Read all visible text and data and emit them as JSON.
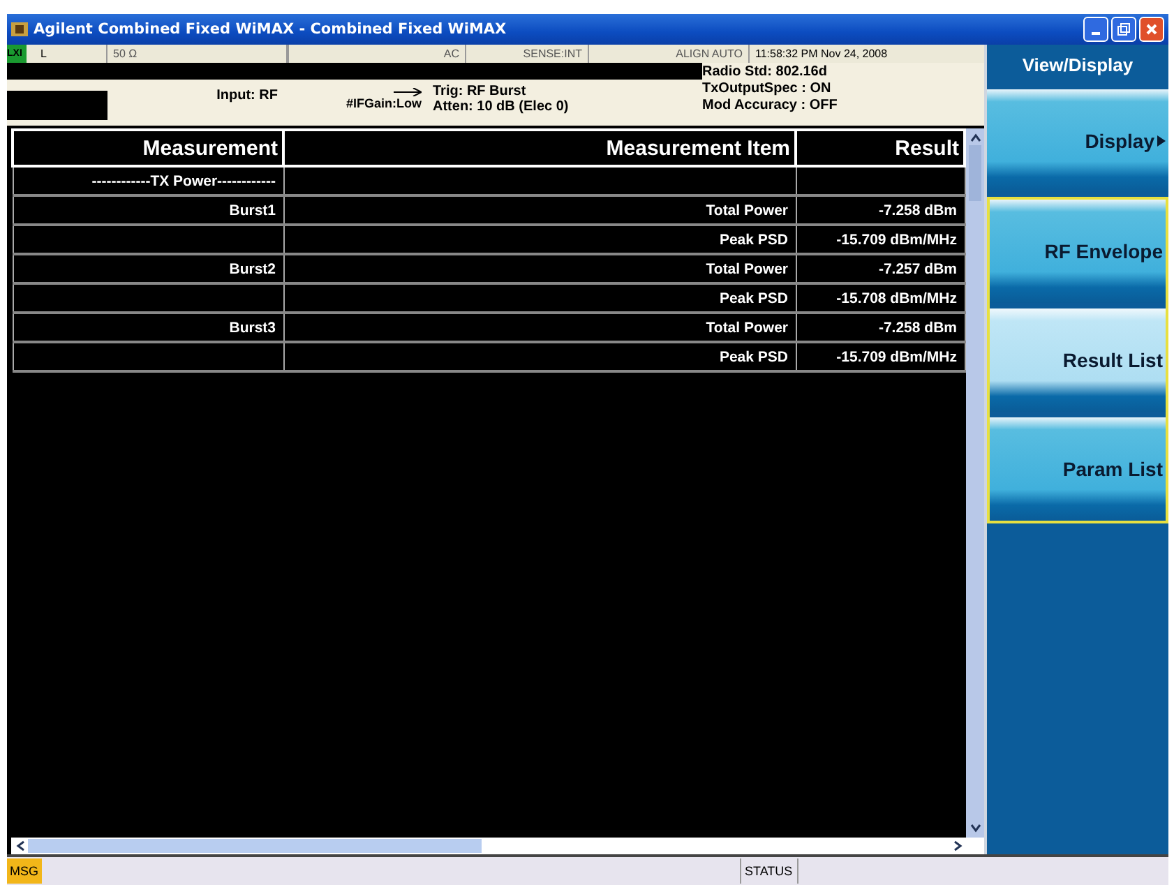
{
  "window": {
    "title": "Agilent Combined Fixed WiMAX - Combined Fixed WiMAX"
  },
  "status_strip": {
    "indicator": "LXI",
    "cells": [
      "L",
      "50 Ω",
      "AC",
      "SENSE:INT",
      "ALIGN AUTO"
    ],
    "datetime": "11:58:32 PM Nov 24, 2008"
  },
  "info": {
    "input": "Input: RF",
    "if_gain": "#IFGain:Low",
    "trigger": "Trig: RF Burst",
    "atten": "Atten: 10 dB (Elec 0)",
    "radio_lines": [
      "Radio Std: 802.16d",
      "TxOutputSpec : ON",
      "Mod Accuracy : OFF"
    ]
  },
  "table": {
    "columns": [
      "Measurement",
      "Measurement Item",
      "Result"
    ],
    "rows": [
      {
        "measurement": "------------TX Power------------",
        "item": "",
        "result": ""
      },
      {
        "measurement": "Burst1",
        "item": "Total Power",
        "result": "-7.258 dBm"
      },
      {
        "measurement": "",
        "item": "Peak PSD",
        "result": "-15.709 dBm/MHz"
      },
      {
        "measurement": "Burst2",
        "item": "Total Power",
        "result": "-7.257 dBm"
      },
      {
        "measurement": "",
        "item": "Peak PSD",
        "result": "-15.708 dBm/MHz"
      },
      {
        "measurement": "Burst3",
        "item": "Total Power",
        "result": "-7.258 dBm"
      },
      {
        "measurement": "",
        "item": "Peak PSD",
        "result": "-15.709 dBm/MHz"
      }
    ]
  },
  "softkeys": {
    "title": "View/Display",
    "keys": [
      {
        "label": "Display",
        "submenu": true,
        "selected": false,
        "grouped": false
      },
      {
        "label": "RF Envelope",
        "submenu": false,
        "selected": false,
        "grouped": true
      },
      {
        "label": "Result List",
        "submenu": false,
        "selected": true,
        "grouped": true
      },
      {
        "label": "Param List",
        "submenu": false,
        "selected": false,
        "grouped": true
      }
    ]
  },
  "bottom_bar": {
    "msg": "MSG",
    "status": "STATUS"
  }
}
